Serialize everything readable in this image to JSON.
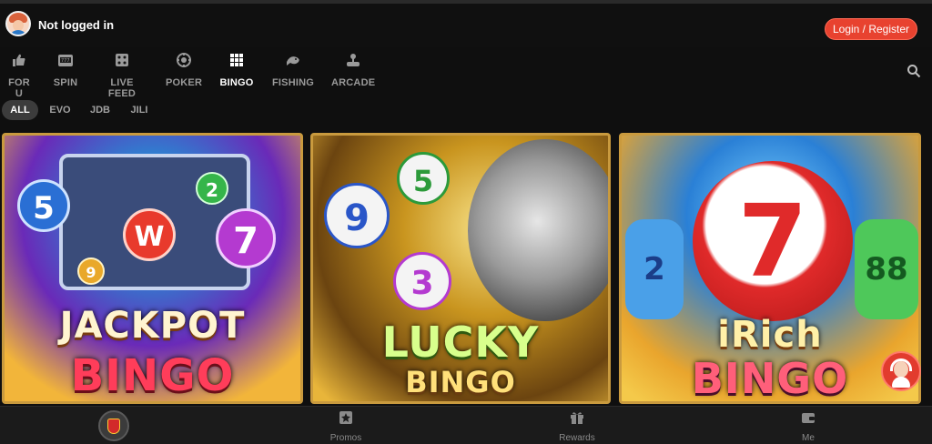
{
  "header": {
    "status_text": "Not logged in",
    "login_label": "Login / Register",
    "accent_color": "#e8422f"
  },
  "categories": [
    {
      "label": "FOR U",
      "icon": "thumbs-up-icon"
    },
    {
      "label": "SPIN",
      "icon": "slot-machine-icon"
    },
    {
      "label": "LIVE FEED",
      "icon": "dice-icon"
    },
    {
      "label": "POKER",
      "icon": "poker-chip-icon"
    },
    {
      "label": "BINGO",
      "icon": "bingo-grid-icon",
      "active": true
    },
    {
      "label": "FISHING",
      "icon": "fish-icon"
    },
    {
      "label": "ARCADE",
      "icon": "joystick-icon"
    }
  ],
  "providers": [
    {
      "label": "ALL",
      "active": true
    },
    {
      "label": "EVO"
    },
    {
      "label": "JDB"
    },
    {
      "label": "JILI"
    }
  ],
  "games": [
    {
      "title_line1": "JACKPOT",
      "title_line2": "BINGO",
      "balls": [
        "5",
        "W",
        "2",
        "7",
        "9"
      ]
    },
    {
      "title_line1": "LUCKY",
      "title_line2": "BINGO",
      "balls": [
        "9",
        "5",
        "3"
      ]
    },
    {
      "title_line1": "iRich",
      "title_line2": "BINGO",
      "balls": [
        "7",
        "2",
        "88"
      ]
    }
  ],
  "bottom_nav": [
    {
      "label": "",
      "icon": "home-logo-icon"
    },
    {
      "label": "Promos",
      "icon": "star-ticket-icon"
    },
    {
      "label": "Rewards",
      "icon": "gift-icon"
    },
    {
      "label": "Me",
      "icon": "wallet-icon"
    }
  ]
}
